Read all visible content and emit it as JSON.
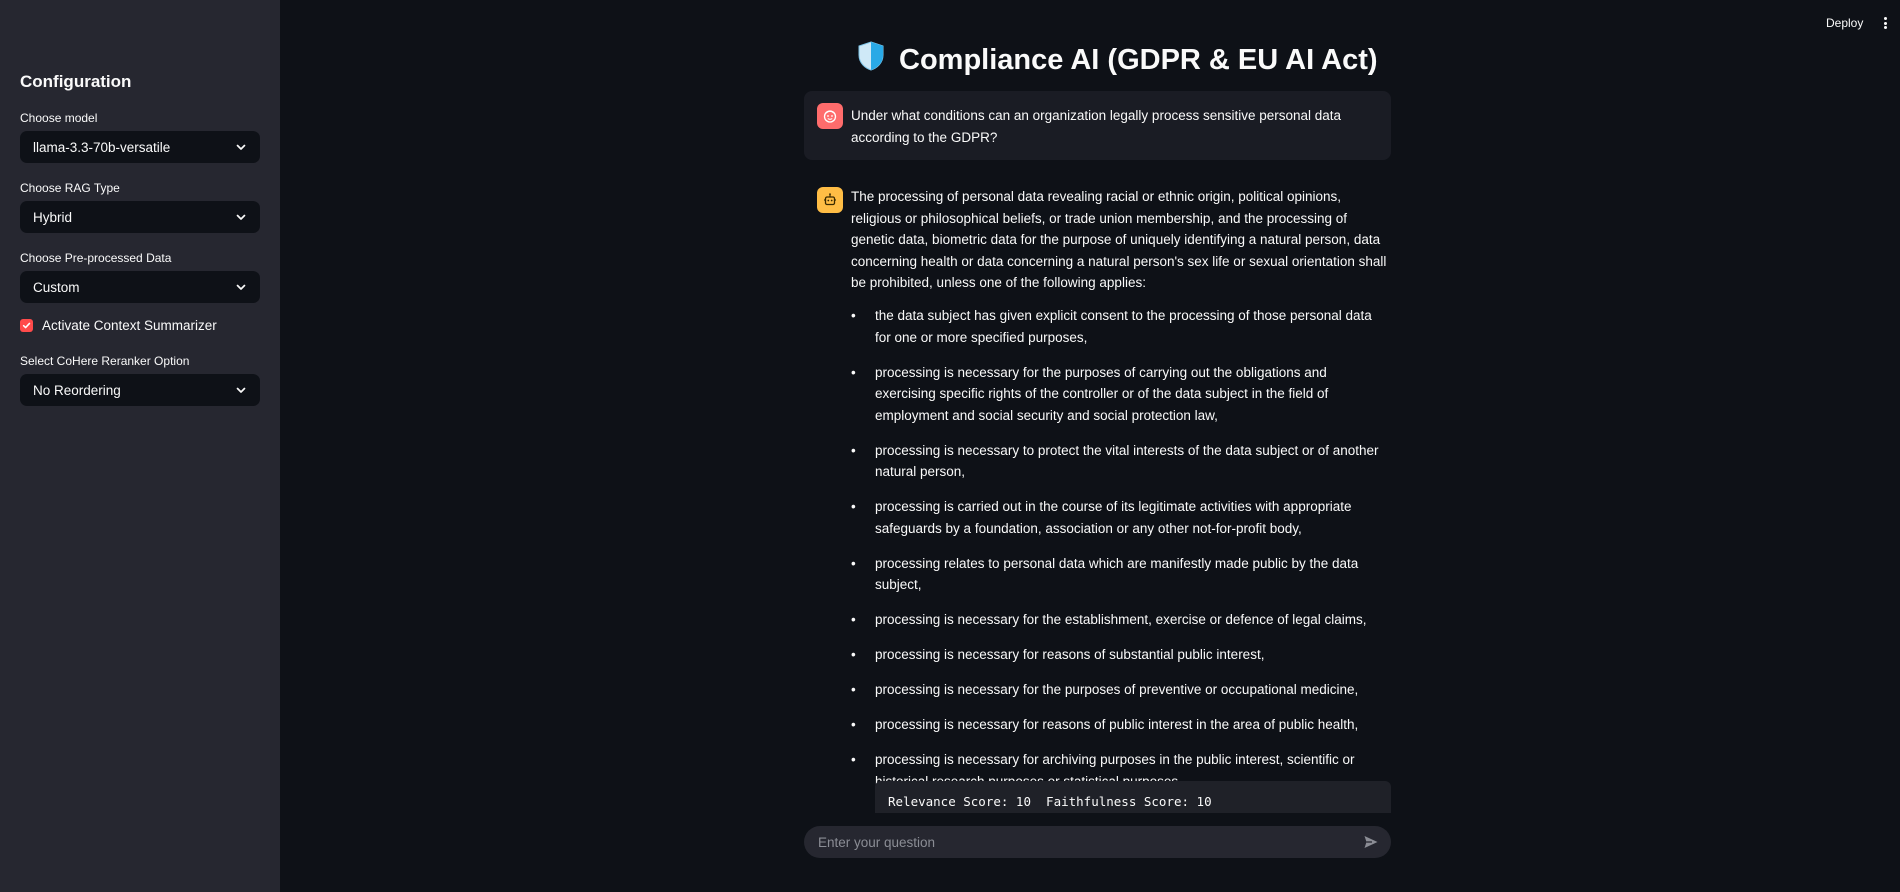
{
  "sidebar": {
    "title": "Configuration",
    "model_label": "Choose model",
    "model_value": "llama-3.3-70b-versatile",
    "rag_label": "Choose RAG Type",
    "rag_value": "Hybrid",
    "data_label": "Choose Pre-processed Data",
    "data_value": "Custom",
    "summarizer_label": "Activate Context Summarizer",
    "summarizer_checked": true,
    "reranker_label": "Select CoHere Reranker Option",
    "reranker_value": "No Reordering"
  },
  "header": {
    "deploy_label": "Deploy"
  },
  "page": {
    "title": "Compliance AI (GDPR & EU AI Act)"
  },
  "chat": {
    "user_message": "Under what conditions can an organization legally process sensitive personal data according to the GDPR?",
    "assistant_intro": "The processing of personal data revealing racial or ethnic origin, political opinions, religious or philosophical beliefs, or trade union membership, and the processing of genetic data, biometric data for the purpose of uniquely identifying a natural person, data concerning health or data concerning a natural person's sex life or sexual orientation shall be prohibited, unless one of the following applies:",
    "bullets": [
      "the data subject has given explicit consent to the processing of those personal data for one or more specified purposes,",
      "processing is necessary for the purposes of carrying out the obligations and exercising specific rights of the controller or of the data subject in the field of employment and social security and social protection law,",
      "processing is necessary to protect the vital interests of the data subject or of another natural person,",
      "processing is carried out in the course of its legitimate activities with appropriate safeguards by a foundation, association or any other not-for-profit body,",
      "processing relates to personal data which are manifestly made public by the data subject,",
      "processing is necessary for the establishment, exercise or defence of legal claims,",
      "processing is necessary for reasons of substantial public interest,",
      "processing is necessary for the purposes of preventive or occupational medicine,",
      "processing is necessary for reasons of public interest in the area of public health,",
      "processing is necessary for archiving purposes in the public interest, scientific or historical research purposes or statistical purposes."
    ],
    "scores": "Relevance Score: 10  Faithfulness Score: 10",
    "input_placeholder": "Enter your question"
  },
  "colors": {
    "accent": "#ff4b4b",
    "user_avatar": "#ff6c6c",
    "assistant_avatar": "#ffbd45",
    "background": "#0e1117",
    "sidebar": "#262730"
  },
  "icons": {
    "title_icon": "shield-icon",
    "user_avatar": "user-face-icon",
    "assistant_avatar": "robot-icon",
    "send": "send-icon",
    "menu": "kebab-menu-icon"
  }
}
